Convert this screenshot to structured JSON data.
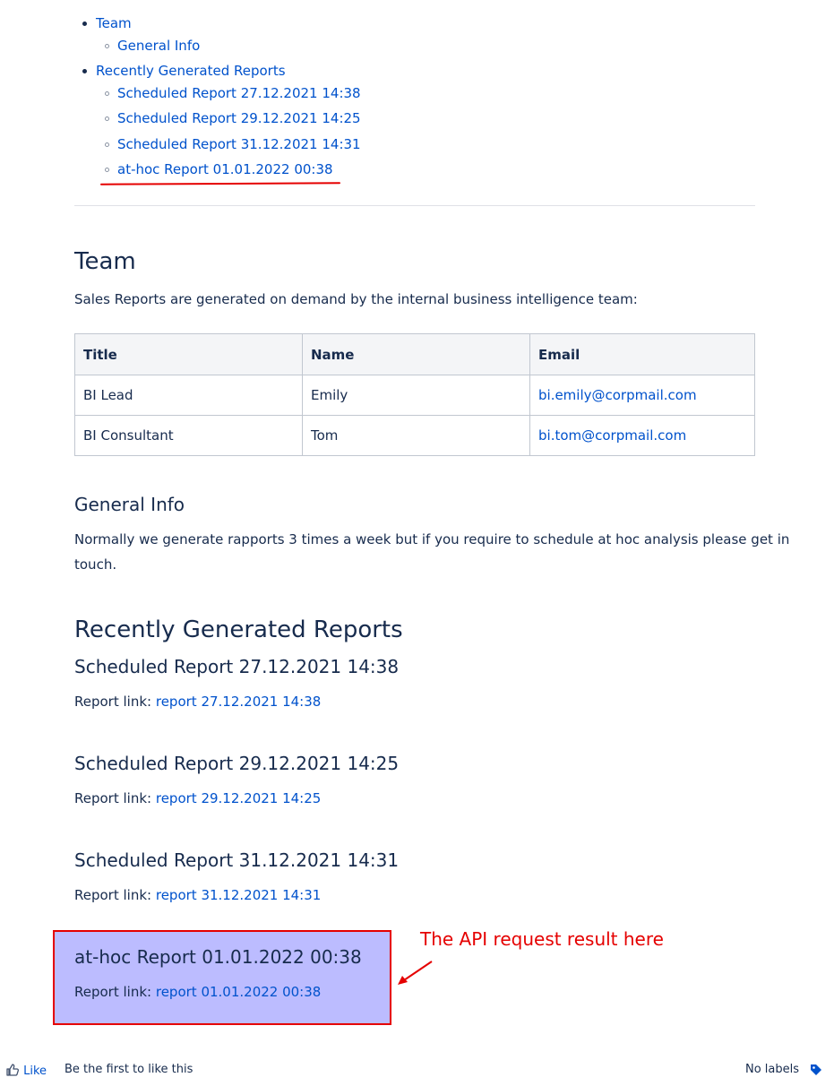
{
  "toc": {
    "team": "Team",
    "general_info": "General Info",
    "recent": "Recently Generated Reports",
    "reports": [
      "Scheduled Report 27.12.2021 14:38",
      "Scheduled Report 29.12.2021 14:25",
      "Scheduled Report 31.12.2021 14:31",
      "at-hoc Report 01.01.2022 00:38"
    ]
  },
  "team": {
    "heading": "Team",
    "description": "Sales Reports are generated on demand by the internal business intelligence team:",
    "table": {
      "headers": [
        "Title",
        "Name",
        "Email"
      ],
      "rows": [
        [
          "BI Lead",
          "Emily",
          "bi.emily@corpmail.com"
        ],
        [
          "BI Consultant",
          "Tom",
          "bi.tom@corpmail.com"
        ]
      ]
    }
  },
  "general_info": {
    "heading": "General Info",
    "line1": "Normally we generate rapports 3 times a week but if you require to schedule at hoc analysis please get in",
    "line2": "touch."
  },
  "recent": {
    "heading": "Recently Generated Reports",
    "link_prefix": "Report link:",
    "reports": [
      {
        "title": "Scheduled Report 27.12.2021 14:38",
        "link": "report 27.12.2021 14:38"
      },
      {
        "title": "Scheduled Report 29.12.2021 14:25",
        "link": "report 29.12.2021 14:25"
      },
      {
        "title": "Scheduled Report 31.12.2021 14:31",
        "link": "report 31.12.2021 14:31"
      },
      {
        "title": "at-hoc Report 01.01.2022 00:38",
        "link": "report 01.01.2022 00:38"
      }
    ]
  },
  "annotation": {
    "text": "The API request result here",
    "color": "#e50000",
    "highlight_color": "#bcbcff"
  },
  "footer": {
    "like_label": "Like",
    "like_prompt": "Be the first to like this",
    "labels_text": "No labels",
    "like_icon": "thumbs-up-icon",
    "label_icon": "tag-icon"
  }
}
